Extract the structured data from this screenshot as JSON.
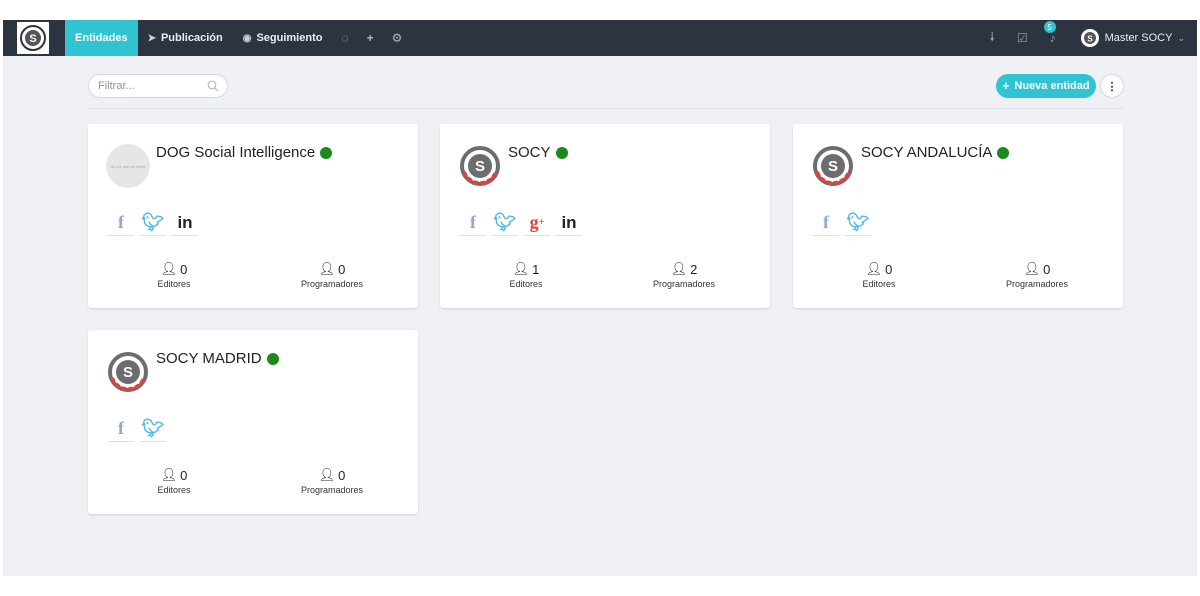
{
  "nav": {
    "items": [
      {
        "label": "Entidades",
        "active": true
      },
      {
        "label": "Publicación"
      },
      {
        "label": "Seguimiento"
      }
    ]
  },
  "notifications": {
    "count": "5"
  },
  "user": {
    "name": "Master SOCY"
  },
  "toolbar": {
    "filter_placeholder": "Filtrar...",
    "new_entity_label": "Nueva entidad"
  },
  "colors": {
    "accent": "#31c3d1",
    "topbar": "#2b3440",
    "online": "#1a8a1a"
  },
  "entities": [
    {
      "name": "DOG Social Intelligence",
      "avatar_text": "do not use as prefix",
      "socials": [
        "facebook",
        "twitter",
        "linkedin"
      ],
      "editors": "0",
      "editors_label": "Editores",
      "programmers": "0",
      "programmers_label": "Programadores"
    },
    {
      "name": "SOCY",
      "socials": [
        "facebook",
        "twitter",
        "google-plus",
        "linkedin"
      ],
      "editors": "1",
      "editors_label": "Editores",
      "programmers": "2",
      "programmers_label": "Programadores"
    },
    {
      "name": "SOCY ANDALUCÍA",
      "socials": [
        "facebook",
        "twitter"
      ],
      "editors": "0",
      "editors_label": "Editores",
      "programmers": "0",
      "programmers_label": "Programadores"
    },
    {
      "name": "SOCY MADRID",
      "socials": [
        "facebook",
        "twitter"
      ],
      "editors": "0",
      "editors_label": "Editores",
      "programmers": "0",
      "programmers_label": "Programadores"
    }
  ]
}
